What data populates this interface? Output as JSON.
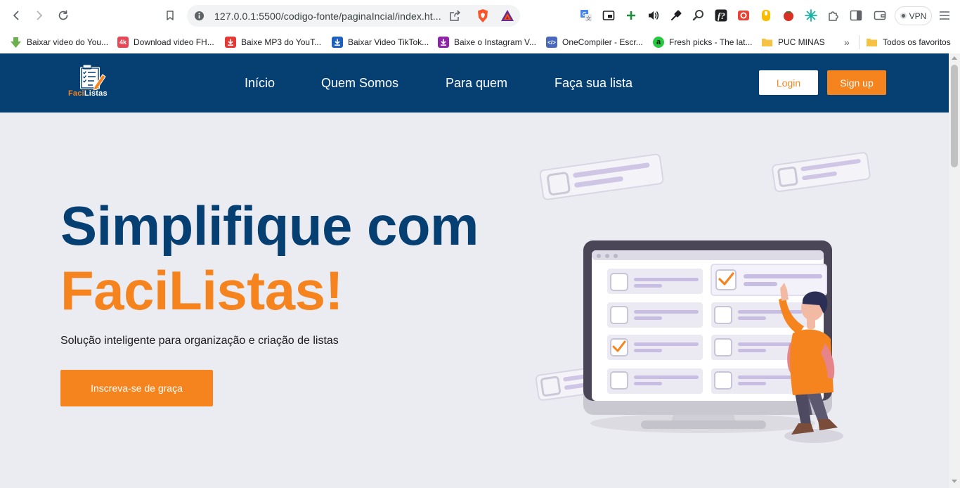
{
  "browser": {
    "url": "127.0.0.1:5500/codigo-fonte/paginaIncial/index.ht...",
    "vpn_label": "VPN",
    "toolbar_icons": [
      "back-icon",
      "forward-icon",
      "reload-icon",
      "bookmark-icon",
      "site-info-icon",
      "share-icon",
      "brave-shields-icon",
      "brave-rewards-icon",
      "translate-icon",
      "picture-in-picture-icon",
      "plus-extension-icon",
      "audio-icon",
      "eyedropper-icon",
      "search-extension-icon",
      "f-extension-icon",
      "camera-extension-icon",
      "hand-extension-icon",
      "tomato-extension-icon",
      "sparkle-extension-icon",
      "extensions-puzzle-icon",
      "sidebar-icon",
      "wallet-icon",
      "menu-icon"
    ]
  },
  "bookmarks": {
    "items": [
      {
        "label": "Baixar video do You...",
        "icon": "download-arrow-icon",
        "color": "#6ab04c"
      },
      {
        "label": "Download video FH...",
        "icon": "4k-icon",
        "color": "#e84855"
      },
      {
        "label": "Baixe MP3 do YouT...",
        "icon": "download-icon",
        "color": "#e53935"
      },
      {
        "label": "Baixar Video TikTok...",
        "icon": "download-icon",
        "color": "#1e5fbf"
      },
      {
        "label": "Baixe o Instagram V...",
        "icon": "download-icon",
        "color": "#8e24aa"
      },
      {
        "label": "OneCompiler - Escr...",
        "icon": "code-icon",
        "color": "#4a69bd"
      },
      {
        "label": "Fresh picks - The lat...",
        "icon": "a-logo-icon",
        "color": "#27c93f"
      },
      {
        "label": "PUC MINAS",
        "icon": "folder-icon",
        "color": "#f6c244"
      }
    ],
    "overflow_label": "»",
    "all_favorites_label": "Todos os favoritos"
  },
  "site": {
    "logo": {
      "part1": "Faci",
      "part2": "Listas"
    },
    "nav": [
      "Início",
      "Quem Somos",
      "Para quem",
      "Faça sua lista"
    ],
    "login_label": "Login",
    "signup_label": "Sign up",
    "hero": {
      "title_line1": "Simplifique com",
      "title_line2": "FaciListas!",
      "subtitle": "Solução inteligente para organização e criação de listas",
      "cta_label": "Inscreva-se de graça"
    }
  },
  "colors": {
    "navbar": "#063f72",
    "accent": "#f5841f",
    "page_background": "#ebebf2",
    "title_blue": "#063f72"
  }
}
